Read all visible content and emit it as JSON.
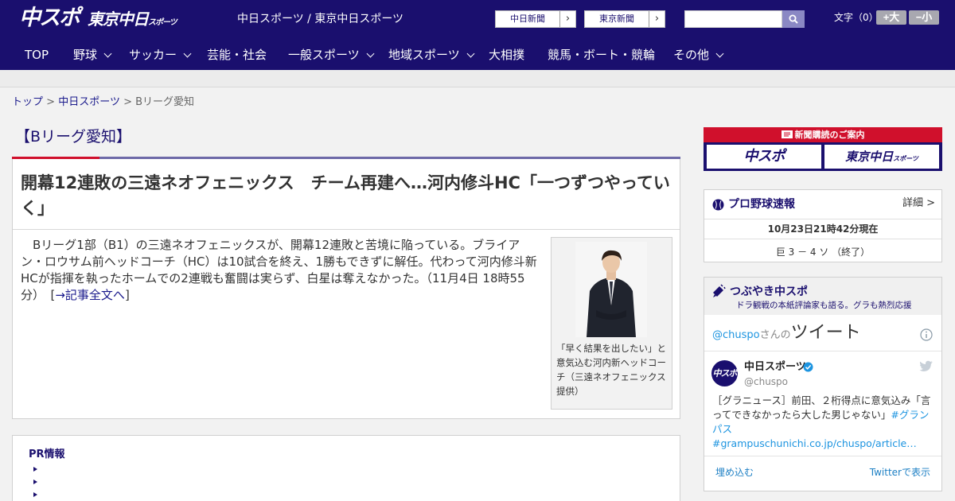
{
  "header": {
    "logo_main": "中スポ",
    "logo_tokyo": "東京中日",
    "logo_tokyo_small": "スポーツ",
    "site_name": "中日スポーツ / 東京中日スポーツ",
    "ext_link_1": "中日新聞",
    "ext_link_2": "東京新聞",
    "arrow": "›",
    "search_placeholder": "",
    "font_size_label": "文字（0）",
    "font_up": "+大",
    "font_down": "−小"
  },
  "nav": {
    "items": [
      {
        "label": "TOP"
      },
      {
        "label": "野球"
      },
      {
        "label": "サッカー"
      },
      {
        "label": "芸能・社会"
      },
      {
        "label": "一般スポーツ"
      },
      {
        "label": "地域スポーツ"
      },
      {
        "label": "大相撲"
      },
      {
        "label": "競馬・ボート・競輪"
      },
      {
        "label": "その他"
      }
    ]
  },
  "breadcrumb": {
    "home": "トップ",
    "section": "中日スポーツ",
    "current": "Bリーグ愛知",
    "sep": ">"
  },
  "category": "【Bリーグ愛知】",
  "article": {
    "title": "開幕12連敗の三遠ネオフェニックス　チーム再建へ…河内修斗HC「一つずつやっていく」",
    "body": "　Bリーグ1部（B1）の三遠ネオフェニックスが、開幕12連敗と苦境に陥っている。ブライアン・ロウサム前ヘッドコーチ（HC）は10試合を終え、1勝もできずに解任。代わって河内修斗新HCが指揮を執ったホームでの2連戦も奮闘は実らず、白星は奪えなかった。（11月4日 18時55分）　[",
    "read_more": "→記事全文へ",
    "body_end": "]",
    "photo_caption": "「早く結果を出したい」と意気込む河内新ヘッドコーチ（三遠ネオフェニックス提供）"
  },
  "pr": {
    "title": "PR情報"
  },
  "subscribe": {
    "header": "新聞購読のご案内",
    "logo1": "中スポ",
    "logo2": "東京中日",
    "logo2_small": "スポーツ"
  },
  "baseball": {
    "title": "プロ野球速報",
    "detail": "詳細 >",
    "time": "10月23日21時42分現在",
    "score": "巨 3 － 4 ソ （終了）"
  },
  "tweets": {
    "title": "つぶやき中スポ",
    "subtitle": "ドラ観戦の本紙評論家も語る。グラも熱烈応援",
    "handle_prefix": "@chuspo",
    "handle_suffix": "さんの",
    "header_big": "ツイート",
    "author": "中日スポーツ",
    "handle": "@chuspo",
    "avatar": "中スポ",
    "text": "［グラニュース］前田、２桁得点に意気込み「言ってできなかったら大した男じゃない」",
    "tag1": "#グランパス",
    "tag2": "#",
    "link": "grampuschunichi.co.jp/chuspo/article…",
    "embed": "埋め込む",
    "view": "Twitterで表示"
  },
  "colors": {
    "brand_navy": "#1a0f6e",
    "accent_red": "#d0102c",
    "twitter_blue": "#1c94e0"
  }
}
